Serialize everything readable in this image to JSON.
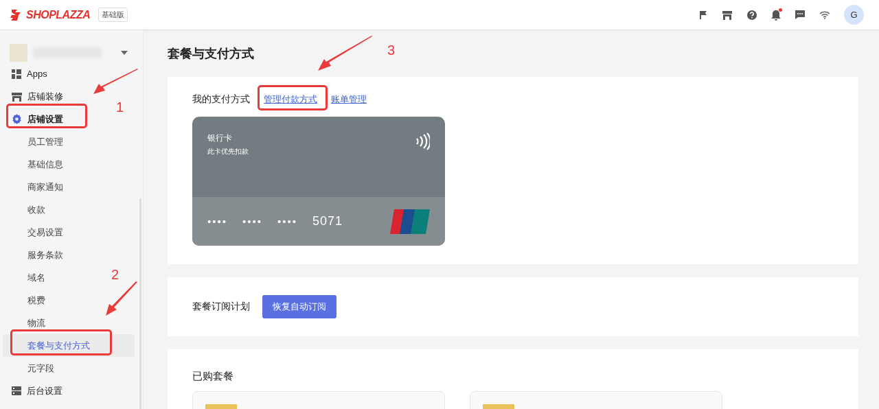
{
  "header": {
    "logo": "SHOPLAZZA",
    "plan_badge": "基础版",
    "notification_dot": true,
    "avatar": "G"
  },
  "sidebar": {
    "items": [
      {
        "label": "Apps",
        "selected": false
      },
      {
        "label": "店铺装修",
        "selected": false
      },
      {
        "label": "店铺设置",
        "selected": false,
        "expanded": true,
        "children": [
          {
            "label": "员工管理",
            "selected": false
          },
          {
            "label": "基础信息",
            "selected": false
          },
          {
            "label": "商家通知",
            "selected": false
          },
          {
            "label": "收款",
            "selected": false
          },
          {
            "label": "交易设置",
            "selected": false
          },
          {
            "label": "服务条款",
            "selected": false
          },
          {
            "label": "域名",
            "selected": false
          },
          {
            "label": "税费",
            "selected": false
          },
          {
            "label": "物流",
            "selected": false
          },
          {
            "label": "套餐与支付方式",
            "selected": true
          },
          {
            "label": "元字段",
            "selected": false
          }
        ]
      },
      {
        "label": "后台设置",
        "selected": false
      }
    ]
  },
  "page": {
    "title": "套餐与支付方式",
    "payment": {
      "label": "我的支付方式",
      "links": [
        "管理付款方式",
        "账单管理"
      ],
      "card": {
        "type": "银行卡",
        "note": "此卡优先扣款",
        "masked": [
          "••••",
          "••••",
          "••••"
        ],
        "last4": "5071"
      }
    },
    "subscription": {
      "label": "套餐订阅计划",
      "button": "恢复自动订阅"
    },
    "purchased": {
      "label": "已购套餐",
      "plans": [
        {
          "color": "#e8c35a"
        },
        {
          "color": "#e8c35a"
        }
      ]
    }
  },
  "annotations": [
    "1",
    "2",
    "3"
  ]
}
